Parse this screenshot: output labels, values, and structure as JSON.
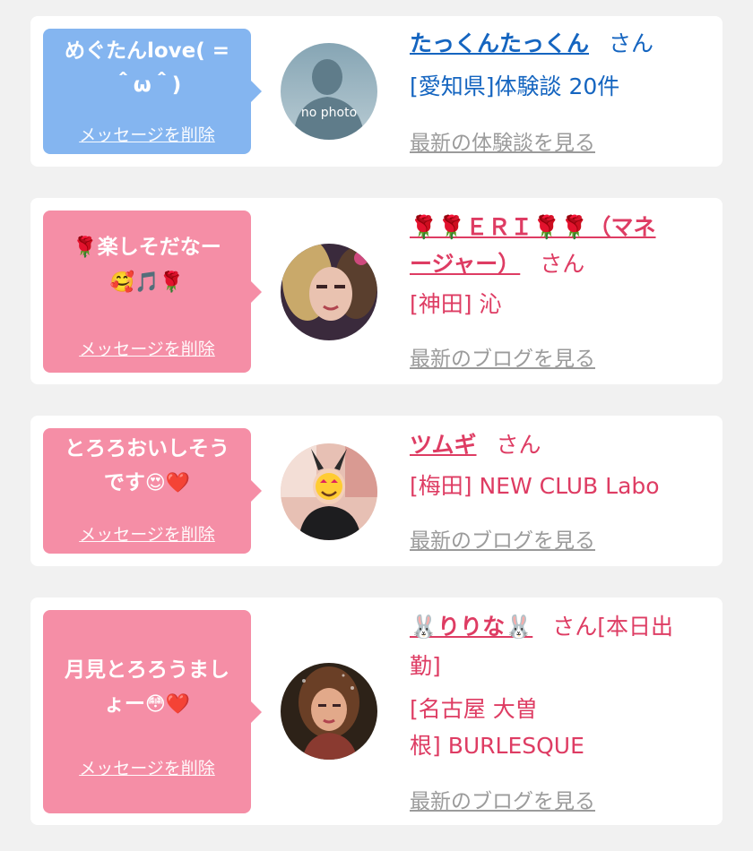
{
  "delete_label": "メッセージを削除",
  "colors": {
    "bubble_blue": "#84b5f0",
    "bubble_pink": "#f58ea6",
    "name_blue": "#1565c0",
    "name_pink": "#de3c63",
    "link_gray": "#9b9b9b"
  },
  "cards": [
    {
      "message": "めぐたんlove( =\n＾ω＾)",
      "avatar_label": "no photo",
      "name": "たっくんたっくん",
      "san": "さん",
      "detail": "[愛知県]体験談 20件",
      "link": "最新の体験談を見る"
    },
    {
      "message_emoji1": "🌹",
      "message": "楽しそだなー",
      "message_emoji2": "🥰🎵🌹",
      "name_line1": "🌹🌹ＥＲＩ🌹🌹（マネ",
      "name_line2": "ージャー）",
      "san": "さん",
      "detail": "[神田] 沁",
      "link": "最新のブログを見る"
    },
    {
      "message_line1": "とろろおいしそう",
      "message_line2": "です",
      "message_emoji": "😍❤️",
      "name": "ツムギ",
      "san": "さん",
      "detail": "[梅田] NEW CLUB Labo",
      "link": "最新のブログを見る"
    },
    {
      "message_line1": "月見とろろうまし",
      "message_line2": "ょー",
      "message_emoji": "😳❤️",
      "name": "🐰りりな🐰",
      "san": "さん[本日出",
      "detail_line1": "勤]",
      "detail_line2": "[名古屋 大曽",
      "detail_line3": "根] BURLESQUE",
      "link": "最新のブログを見る"
    }
  ]
}
